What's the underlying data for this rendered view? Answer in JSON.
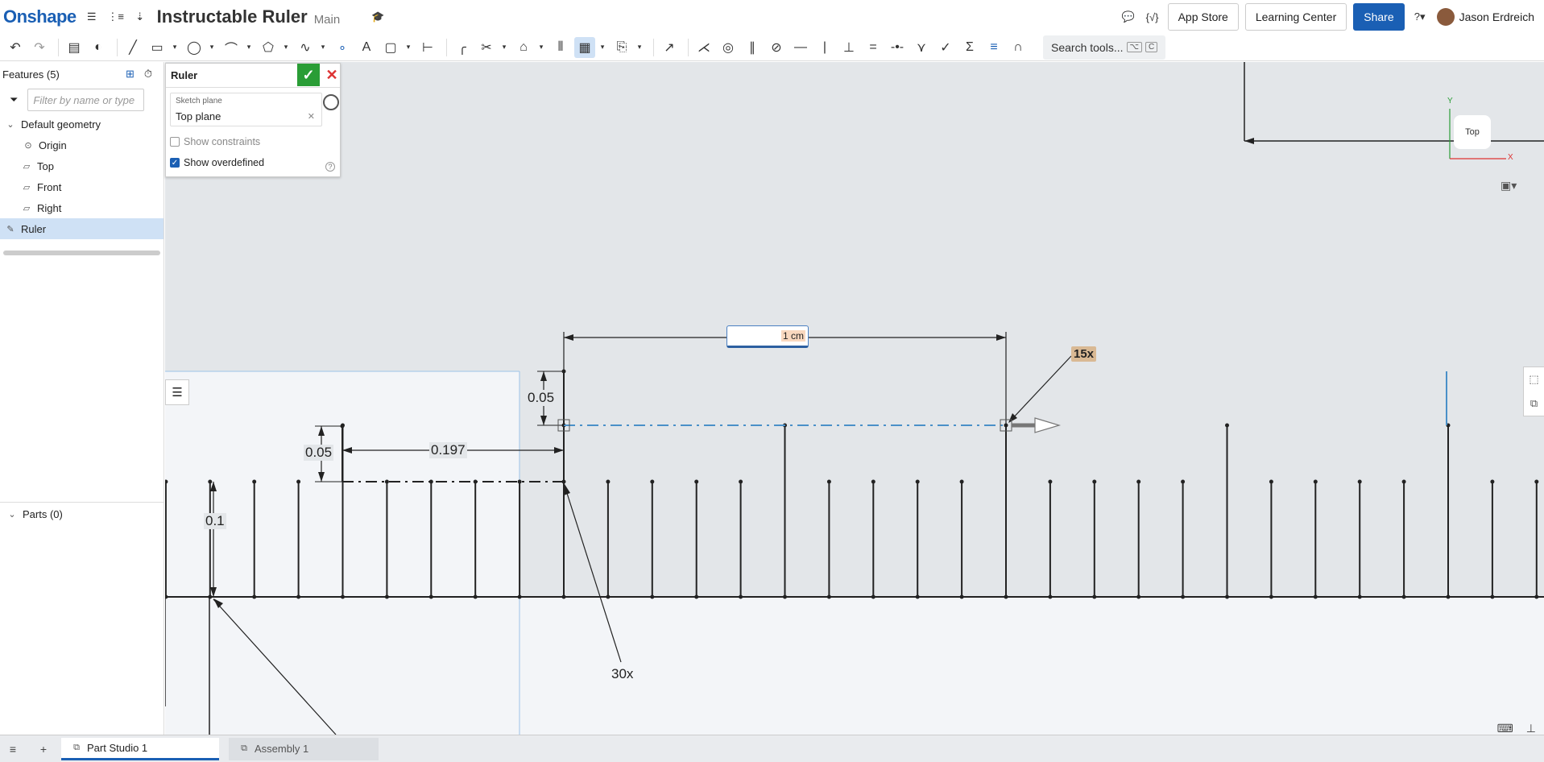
{
  "header": {
    "logo": "Onshape",
    "doc_title": "Instructable Ruler",
    "branch": "Main",
    "app_store": "App Store",
    "learning_center": "Learning Center",
    "share": "Share",
    "user_name": "Jason Erdreich"
  },
  "toolbar": {
    "search_label": "Search tools...",
    "search_shortcut_1": "⌥",
    "search_shortcut_2": "C"
  },
  "features": {
    "title": "Features (5)",
    "filter_placeholder": "Filter by name or type",
    "default_geometry": "Default geometry",
    "items": [
      "Origin",
      "Top",
      "Front",
      "Right"
    ],
    "selected": "Ruler",
    "parts": "Parts (0)"
  },
  "sketch_dialog": {
    "title": "Ruler",
    "plane_label": "Sketch plane",
    "plane_value": "Top plane",
    "show_constraints": "Show constraints",
    "show_overdefined": "Show overdefined",
    "show_constraints_checked": false,
    "show_overdefined_checked": true
  },
  "canvas": {
    "dim_input_value": "1 cm",
    "pattern_count_a": "15x",
    "pattern_count_b": "30x",
    "dim_005_upper": "0.05",
    "dim_005_lower": "0.05",
    "dim_0197": "0.197",
    "dim_01": "0.1",
    "view_cube_face": "Top",
    "axis_x": "X",
    "axis_y": "Y"
  },
  "tabs": {
    "active": "Part Studio 1",
    "inactive": "Assembly 1"
  },
  "colors": {
    "brand": "#1a5fb4",
    "ok_green": "#2a9d36",
    "cancel_red": "#dd3333",
    "badge": "#d9b994"
  }
}
